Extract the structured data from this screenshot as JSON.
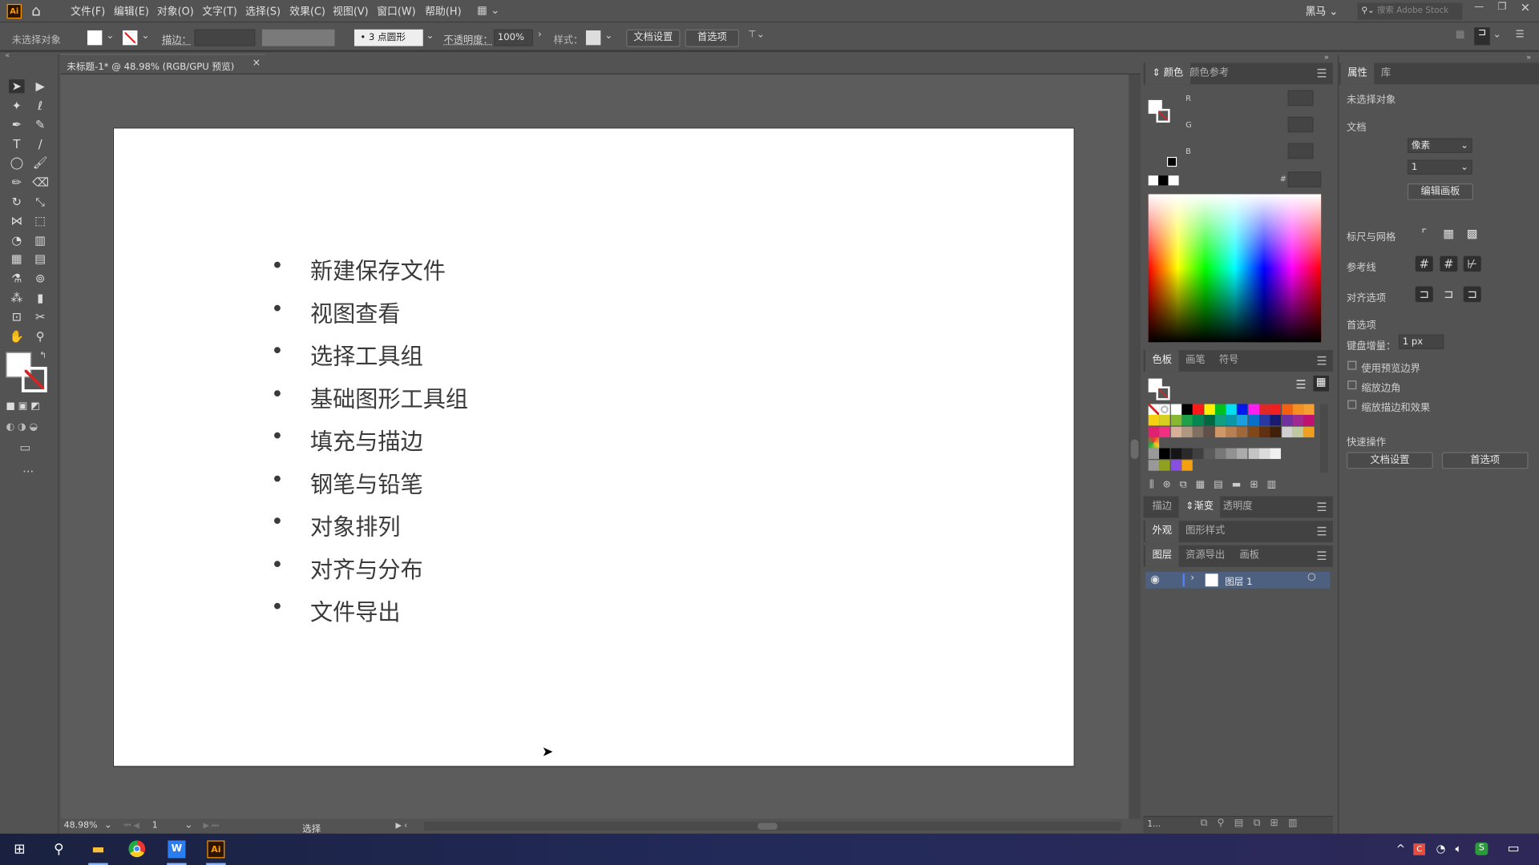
{
  "app": {
    "logo": "Ai",
    "workspace": "黑马",
    "search_placeholder": "搜索 Adobe Stock"
  },
  "menu": [
    "文件(F)",
    "编辑(E)",
    "对象(O)",
    "文字(T)",
    "选择(S)",
    "效果(C)",
    "视图(V)",
    "窗口(W)",
    "帮助(H)"
  ],
  "control": {
    "selection": "未选择对象",
    "stroke_label": "描边：",
    "brush": "3 点圆形",
    "opacity_label": "不透明度：",
    "opacity": "100%",
    "style_label": "样式：",
    "doc_setup": "文档设置",
    "prefs": "首选项"
  },
  "document": {
    "tab": "未标题-1* @ 48.98% (RGB/GPU 预览)",
    "close": "×"
  },
  "artboard": {
    "bullet": "•",
    "items": [
      "新建保存文件",
      "视图查看",
      "选择工具组",
      "基础图形工具组",
      "填充与描边",
      "钢笔与铅笔",
      "对象排列",
      "对齐与分布",
      "文件导出"
    ]
  },
  "status": {
    "zoom": "48.98%",
    "artboard": "1",
    "tool": "选择"
  },
  "color_panel": {
    "tabs": [
      "颜色",
      "颜色参考"
    ],
    "r": "R",
    "g": "G",
    "b": "B",
    "hash": "#"
  },
  "swatch_panel": {
    "tabs": [
      "色板",
      "画笔",
      "符号"
    ],
    "rows": [
      [
        "#ffffff",
        "#000000",
        "#ff1a1a",
        "#ffee00",
        "#00c020",
        "#00e0f0",
        "#0018f0",
        "#ff20f0",
        "#e02828",
        "#f02020",
        "#f26010",
        "#f59020",
        "#f5a030"
      ],
      [
        "#f5d010",
        "#d8d020",
        "#88b830",
        "#20a048",
        "#008850",
        "#006840",
        "#10a080",
        "#0898a8",
        "#1aa0e0",
        "#0870c8",
        "#2838a0",
        "#1a1a70",
        "#7030a0",
        "#a02890",
        "#c01070"
      ],
      [
        "#e02070",
        "#f03080",
        "#d8b098",
        "#b09880",
        "#807060",
        "#605048",
        "#d09868",
        "#b88050",
        "#a06838",
        "#804818",
        "#603010",
        "#402008",
        "#d0d0d0",
        "#c0c8a0",
        "#f0a020"
      ]
    ],
    "grays": [
      "#000000",
      "#151515",
      "#2a2a2a",
      "#404040",
      "#5a5a5a",
      "#777777",
      "#929292",
      "#ababab",
      "#c4c4c4",
      "#dcdcdc",
      "#f0f0f0"
    ],
    "group2": [
      "#90a020",
      "#8850e0",
      "#f5a010"
    ]
  },
  "mid_tabs": {
    "stroke": "描边",
    "gradient": "渐变",
    "transparency": "透明度",
    "appearance": "外观",
    "graphic_styles": "图形样式",
    "layers": "图层",
    "asset_export": "资源导出",
    "artboards": "画板"
  },
  "layers": {
    "name": "图层 1",
    "count": "1..."
  },
  "properties": {
    "tabs": [
      "属性",
      "库"
    ],
    "no_selection": "未选择对象",
    "document": "文档",
    "units": "像素",
    "artboard_num": "1",
    "edit_artboards": "编辑画板",
    "rulers_grids": "标尺与网格",
    "guides": "参考线",
    "snap_options": "对齐选项",
    "preferences": "首选项",
    "keyboard_increment_label": "键盘增量：",
    "keyboard_increment": "1 px",
    "checks": [
      {
        "label": "使用预览边界",
        "checked": false
      },
      {
        "label": "缩放边角",
        "checked": false
      },
      {
        "label": "缩放描边和效果",
        "checked": false
      }
    ],
    "quick_actions": "快速操作",
    "doc_setup": "文档设置",
    "prefs": "首选项"
  },
  "colors": {
    "ui_bg": "#535353",
    "canvas": "#5c5c5c",
    "layer_highlight": "#4d6080",
    "taskbar": "#1f2550"
  }
}
